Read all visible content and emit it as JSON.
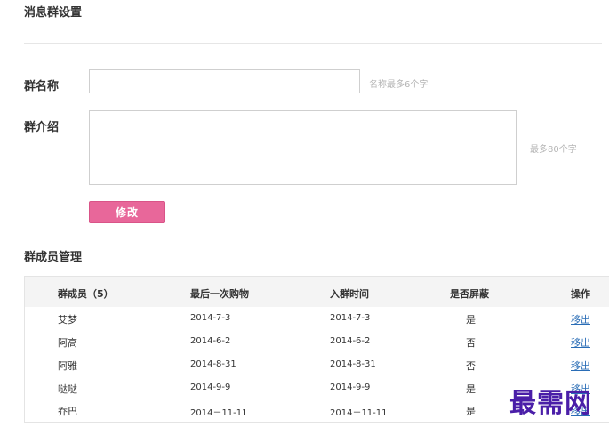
{
  "page": {
    "title": "消息群设置"
  },
  "form": {
    "name_label": "群名称",
    "name_value": "",
    "name_hint": "名称最多6个字",
    "intro_label": "群介绍",
    "intro_value": "",
    "intro_hint": "最多80个字",
    "submit_label": "修改",
    "submit_color": "#e8679a"
  },
  "members": {
    "section_title": "群成员管理",
    "columns": [
      "群成员（5）",
      "最后一次购物",
      "入群时间",
      "是否屏蔽",
      "操作"
    ],
    "rows": [
      {
        "name": "艾梦",
        "last_purchase": "2014-7-3",
        "joined": "2014-7-3",
        "blocked": "是",
        "action": "移出"
      },
      {
        "name": "阿高",
        "last_purchase": "2014-6-2",
        "joined": "2014-6-2",
        "blocked": "否",
        "action": "移出"
      },
      {
        "name": "阿雅",
        "last_purchase": "2014-8-31",
        "joined": "2014-8-31",
        "blocked": "否",
        "action": "移出"
      },
      {
        "name": "哒哒",
        "last_purchase": "2014-9-9",
        "joined": "2014-9-9",
        "blocked": "是",
        "action": "移出"
      },
      {
        "name": "乔巴",
        "last_purchase": "2014－11-11",
        "joined": "2014－11-11",
        "blocked": "是",
        "action": "移出"
      }
    ],
    "link_color": "#2a6db6"
  },
  "watermark": {
    "text": "最需网",
    "color": "#4a1ea8"
  }
}
